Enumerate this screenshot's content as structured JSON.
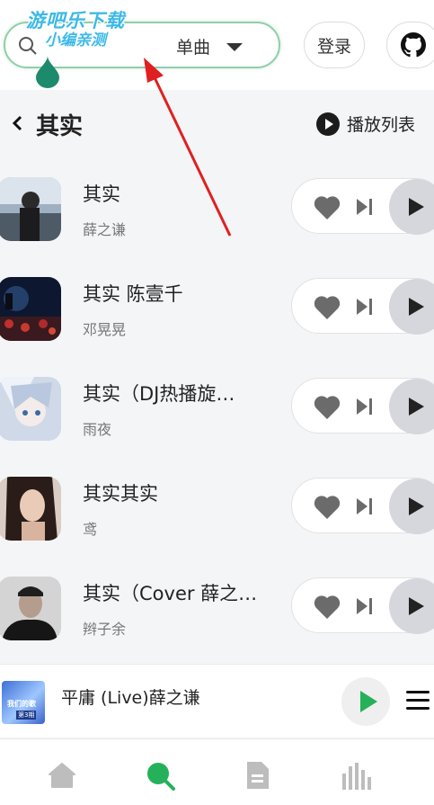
{
  "watermark": {
    "line1": "游吧乐下载",
    "line2": "小编亲测"
  },
  "search": {
    "value": "",
    "placeholder": "",
    "type_label": "单曲"
  },
  "header": {
    "login_label": "登录"
  },
  "page": {
    "title": "其实",
    "playlist_label": "播放列表"
  },
  "songs": [
    {
      "title": "其实",
      "artist": "薛之谦"
    },
    {
      "title": "其实 陈壹千",
      "artist": "邓晃晃"
    },
    {
      "title": "其实（DJ热播旋…",
      "artist": "雨夜"
    },
    {
      "title": "其实其实",
      "artist": "鸢"
    },
    {
      "title": "其实（Cover 薛之…",
      "artist": "辫子余"
    }
  ],
  "player": {
    "title": "平庸 (Live)薛之谦",
    "cover_text": "我们的歌",
    "cover_badge": "第3期"
  },
  "colors": {
    "accent_green": "#25b15a",
    "search_border": "#8fcfaa",
    "annotation_arrow": "#e02020"
  },
  "nav": {
    "tabs": [
      {
        "icon": "home-icon"
      },
      {
        "icon": "search-icon",
        "active": true
      },
      {
        "icon": "document-icon"
      },
      {
        "icon": "equalizer-icon"
      }
    ]
  }
}
